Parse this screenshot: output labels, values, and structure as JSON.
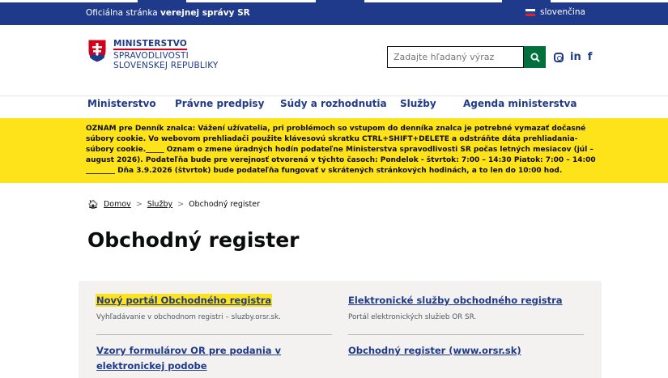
{
  "gov_bar": {
    "official_prefix": "Oficiálna stránka ",
    "official_bold": "verejnej správy SR",
    "language": "slovenčina"
  },
  "logo": {
    "line1": "MINISTERSTVO",
    "line2": "SPRAVODLIVOSTI",
    "line3": "SLOVENSKEJ REPUBLIKY"
  },
  "search": {
    "placeholder": "Zadajte hľadaný výraz",
    "button_icon": "search-icon"
  },
  "social": {
    "linkedin": "in",
    "facebook": "f",
    "instagram_icon": "instagram-icon"
  },
  "nav": {
    "items": [
      {
        "label": "Ministerstvo"
      },
      {
        "label": "Právne predpisy"
      },
      {
        "label": "Súdy a rozhodnutia"
      },
      {
        "label": "Služby"
      },
      {
        "label": "Agenda ministerstva"
      }
    ]
  },
  "notice": {
    "text": "OZNAM pre Denník znalca: Vážení užívatelia, pri problémoch so vstupom do denníka znalca je potrebné vymazať dočasné súbory cookie. Vo webovom prehliadači použite klávesovú skratku CTRL+SHIFT+DELETE a odstráňte dáta prehliadania-súbory cookie._____ Oznam o zmene úradných hodín podateľne Ministerstva spravodlivosti SR počas letných mesiacov (júl – august 2026). Podateľňa bude pre verejnosť otvorená v týchto časoch: Pondelok - štvrtok: 7:00 – 14:30 Piatok: 7:00 – 14:00 ________ Dňa 3.9.2026 (štvrtok) bude podateľňa fungovať v skrátených stránkových hodinách, a to len do 10:00 hod."
  },
  "breadcrumb": {
    "home": "Domov",
    "section": "Služby",
    "current": "Obchodný register",
    "separator": ">"
  },
  "page_title": "Obchodný register",
  "cards": [
    {
      "title": "Nový portál Obchodného registra",
      "desc": "Vyhľadávanie v obchodnom registri – sluzby.orsr.sk."
    },
    {
      "title": "Elektronické služby obchodného registra",
      "desc": "Portál elektronických služieb OR SR."
    },
    {
      "title": "Vzory formulárov OR pre podania v elektronickej podobe",
      "desc": ""
    },
    {
      "title": "Obchodný register (www.orsr.sk)",
      "desc": ""
    }
  ],
  "colors": {
    "gov_blue": "#1f3a8a",
    "notice_yellow": "#ffe31a",
    "search_green": "#00703c",
    "panel_grey": "#f3f2f1"
  }
}
